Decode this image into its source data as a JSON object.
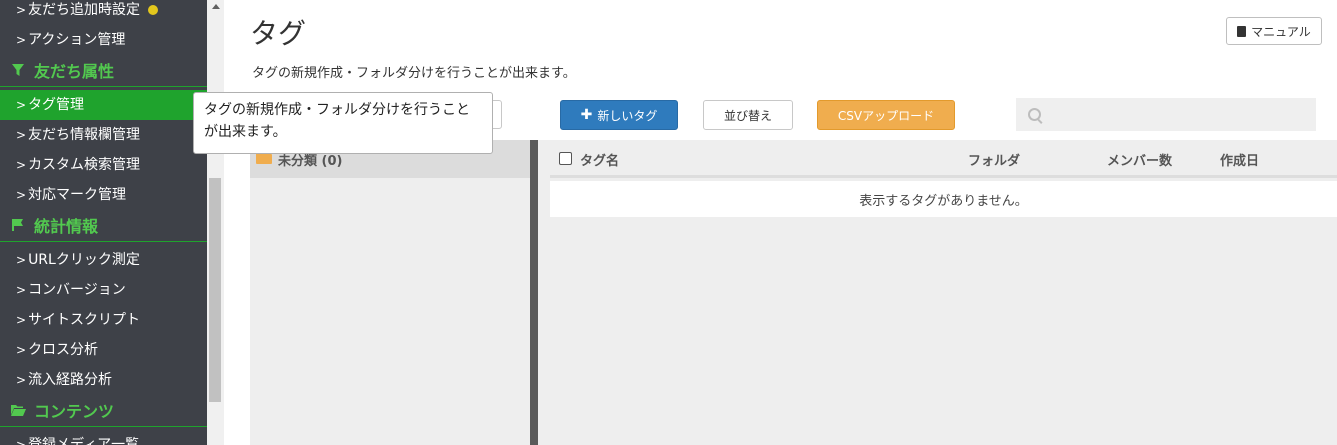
{
  "sidebar": {
    "items": [
      {
        "label": "友だち追加時設定",
        "has_dot": true
      },
      {
        "label": "アクション管理"
      },
      {
        "section": "友だち属性",
        "icon": "filter-icon"
      },
      {
        "label": "タグ管理",
        "active": true
      },
      {
        "label": "友だち情報欄管理"
      },
      {
        "label": "カスタム検索管理"
      },
      {
        "label": "対応マーク管理"
      },
      {
        "section": "統計情報",
        "icon": "flag-icon"
      },
      {
        "label": "URLクリック測定"
      },
      {
        "label": "コンバージョン"
      },
      {
        "label": "サイトスクリプト"
      },
      {
        "label": "クロス分析"
      },
      {
        "label": "流入経路分析"
      },
      {
        "section": "コンテンツ",
        "icon": "folder-open-icon"
      },
      {
        "label": "登録メディア一覧"
      }
    ],
    "chevron": ">"
  },
  "header": {
    "title": "タグ",
    "description": "タグの新規作成・フォルダ分けを行うことが出来ます。",
    "manual_label": "マニュアル"
  },
  "toolbar": {
    "new_tag_label": "新しいタグ",
    "sort_label": "並び替え",
    "csv_label": "CSVアップロード",
    "search_placeholder": ""
  },
  "folders": {
    "uncategorized_label": "未分類 (0)"
  },
  "table": {
    "columns": [
      "タグ名",
      "フォルダ",
      "メンバー数",
      "作成日"
    ],
    "empty_message": "表示するタグがありません。"
  },
  "tooltip": {
    "text": "タグの新規作成・フォルダ分けを行うことが出来ます。"
  },
  "colors": {
    "sidebar_bg": "#3e4148",
    "accent_green": "#1fa32d",
    "section_green": "#52c94f",
    "primary_blue": "#2f7bbd",
    "csv_orange": "#f0ad4e"
  }
}
